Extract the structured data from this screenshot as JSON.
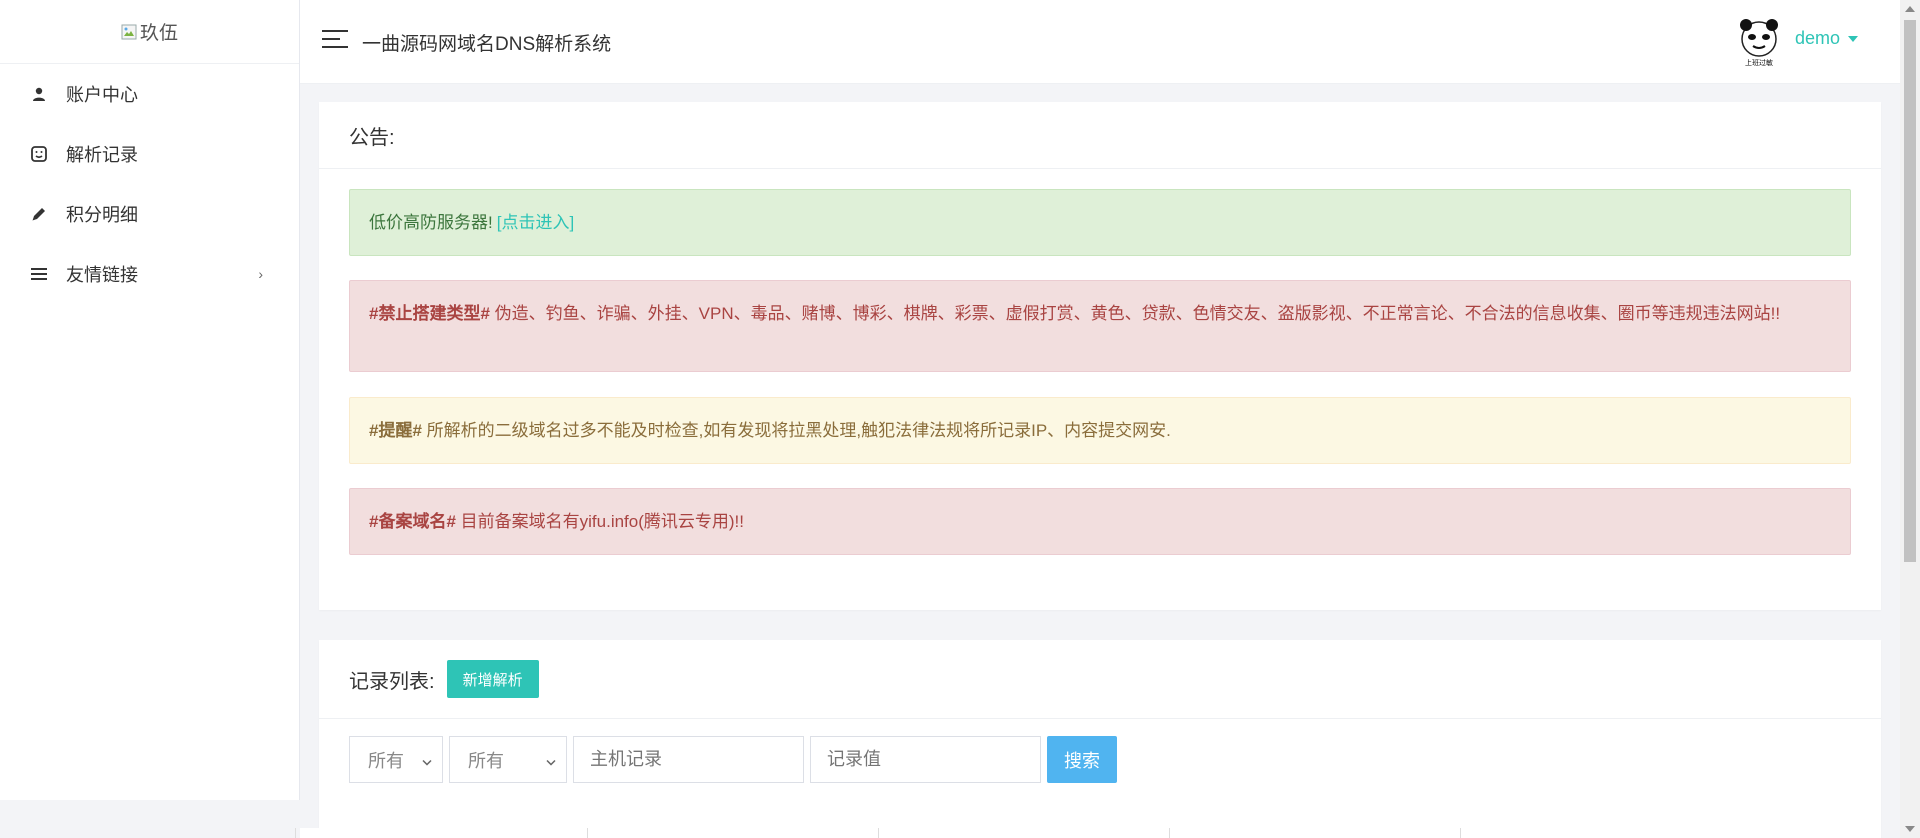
{
  "sidebar": {
    "logo_alt": "玖伍",
    "items": [
      {
        "label": "账户中心",
        "icon": "user-icon"
      },
      {
        "label": "解析记录",
        "icon": "record-icon"
      },
      {
        "label": "积分明细",
        "icon": "pen-icon"
      },
      {
        "label": "友情链接",
        "icon": "list-icon",
        "has_submenu": true
      }
    ]
  },
  "header": {
    "title": "一曲源码网域名DNS解析系统",
    "username": "demo"
  },
  "notice": {
    "title": "公告:",
    "success": {
      "text": "低价高防服务器!",
      "link": "[点击进入]"
    },
    "ban": {
      "tag": "#禁止搭建类型#",
      "text": " 伪造、钓鱼、诈骗、外挂、VPN、毒品、赌博、博彩、棋牌、彩票、虚假打赏、黄色、贷款、色情交友、盗版影视、不正常言论、不合法的信息收集、圈币等违规违法网站!!"
    },
    "remind": {
      "tag": "#提醒#",
      "text": " 所解析的二级域名过多不能及时检查,如有发现将拉黑处理,触犯法律法规将所记录IP、内容提交网安."
    },
    "filing": {
      "tag": "#备案域名#",
      "text": " 目前备案域名有yifu.info(腾讯云专用)!!"
    }
  },
  "records": {
    "title": "记录列表:",
    "add_button": "新增解析",
    "filter1": "所有",
    "filter2": "所有",
    "host_placeholder": "主机记录",
    "value_placeholder": "记录值",
    "search_button": "搜索"
  },
  "colors": {
    "accent": "#2ec4b6",
    "search": "#50b4f0",
    "success_bg": "#dff0d8",
    "danger_bg": "#f2dede",
    "warning_bg": "#fcf8e3"
  }
}
